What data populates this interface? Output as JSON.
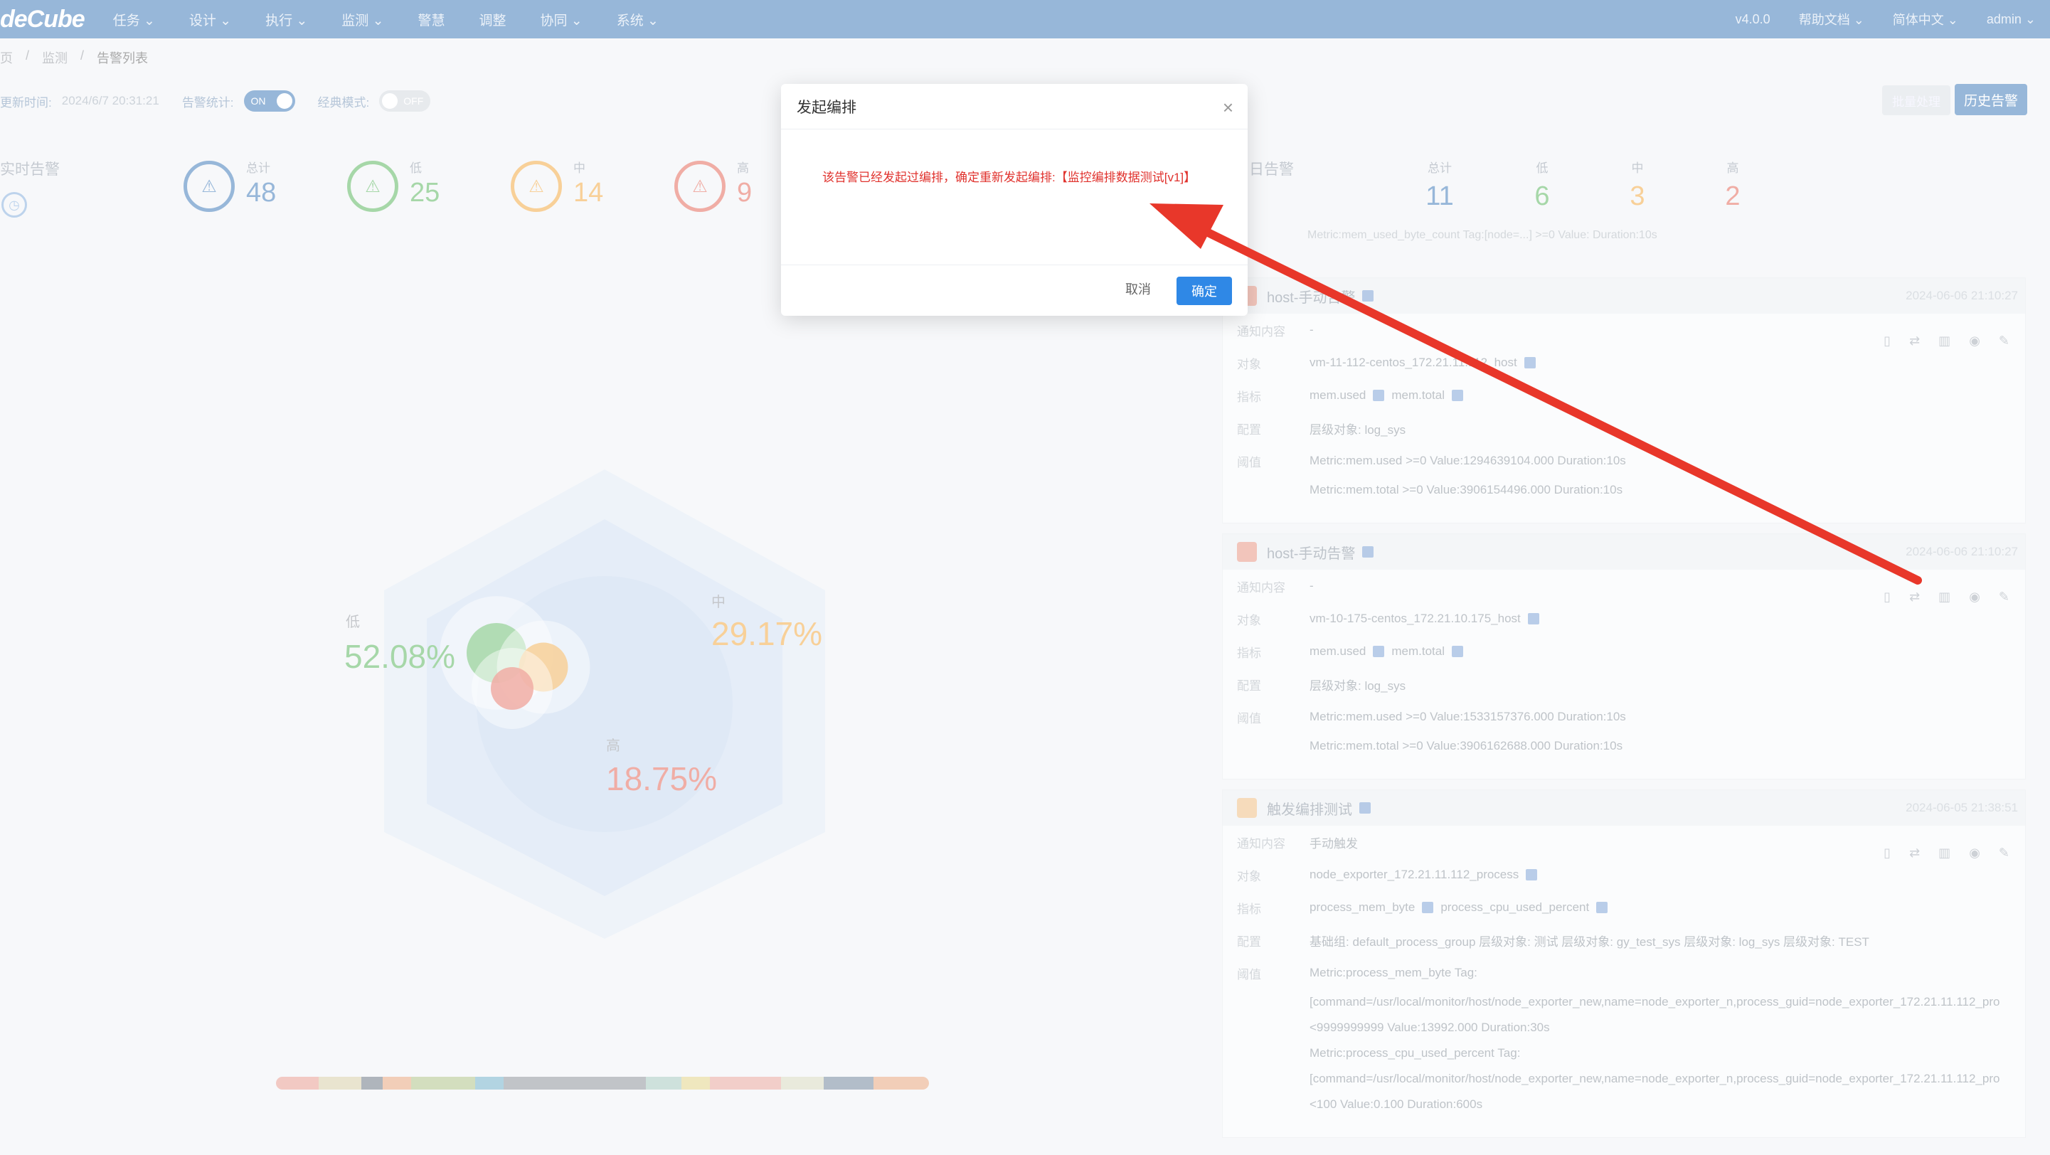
{
  "nav": {
    "logo": "deCube",
    "items": [
      "任务 ⌄",
      "设计 ⌄",
      "执行 ⌄",
      "监测 ⌄",
      "警慧",
      "调整",
      "协同 ⌄",
      "系统 ⌄"
    ],
    "version": "v4.0.0",
    "help": "帮助文档 ⌄",
    "lang": "简体中文 ⌄",
    "user": "admin ⌄"
  },
  "breadcrumb": [
    "页",
    "/",
    "监测",
    "/",
    "告警列表"
  ],
  "toolbar": {
    "update_label": "更新时间:",
    "update_time": "2024/6/7 20:31:21",
    "stats_label": "告警统计:",
    "stats_toggle": "ON",
    "classic_label": "经典模式:",
    "classic_toggle": "OFF",
    "disabled_btn": "批量处理",
    "history_btn": "历史告警"
  },
  "realtime": {
    "title": "实时告警",
    "stats": [
      {
        "label": "总计",
        "value": "48",
        "color": "#2f6fb3"
      },
      {
        "label": "低",
        "value": "25",
        "color": "#4caf50"
      },
      {
        "label": "中",
        "value": "14",
        "color": "#f0a030"
      },
      {
        "label": "高",
        "value": "9",
        "color": "#e05a4a"
      }
    ]
  },
  "chart_data": {
    "type": "pie",
    "categories": [
      "低",
      "中",
      "高"
    ],
    "values": [
      52.08,
      29.17,
      18.75
    ],
    "labels": [
      "52.08%",
      "29.17%",
      "18.75%"
    ],
    "colors": [
      "#4caf50",
      "#f0a030",
      "#e05a4a"
    ]
  },
  "history": {
    "title": "日告警",
    "stats": [
      {
        "label": "总计",
        "value": "11",
        "color": "#2f6fb3"
      },
      {
        "label": "低",
        "value": "6",
        "color": "#4caf50"
      },
      {
        "label": "中",
        "value": "3",
        "color": "#f0a030"
      },
      {
        "label": "高",
        "value": "2",
        "color": "#e05a4a"
      }
    ],
    "top_line": "Metric:mem_used_byte_count Tag:[node=...] >=0 Value:  Duration:10s"
  },
  "cards": [
    {
      "title": "host-手动告警",
      "time": "2024-06-06 21:10:27",
      "notify_k": "通知内容",
      "notify": "-",
      "object_k": "对象",
      "object": "vm-11-112-centos_172.21.11.112_host",
      "metric_k": "指标",
      "metric1": "mem.used",
      "metric2": "mem.total",
      "config_k": "配置",
      "config": "层级对象: log_sys",
      "threshold_k": "阈值",
      "threshold": [
        "Metric:mem.used >=0 Value:1294639104.000 Duration:10s",
        "Metric:mem.total >=0 Value:3906154496.000 Duration:10s"
      ]
    },
    {
      "title": "host-手动告警",
      "time": "2024-06-06 21:10:27",
      "notify_k": "通知内容",
      "notify": "-",
      "object_k": "对象",
      "object": "vm-10-175-centos_172.21.10.175_host",
      "metric_k": "指标",
      "metric1": "mem.used",
      "metric2": "mem.total",
      "config_k": "配置",
      "config": "层级对象: log_sys",
      "threshold_k": "阈值",
      "threshold": [
        "Metric:mem.used >=0 Value:1533157376.000 Duration:10s",
        "Metric:mem.total >=0 Value:3906162688.000 Duration:10s"
      ]
    },
    {
      "title": "触发编排测试",
      "time": "2024-06-05 21:38:51",
      "notify_k": "通知内容",
      "notify": "手动触发",
      "object_k": "对象",
      "object": "node_exporter_172.21.11.112_process",
      "metric_k": "指标",
      "metric1": "process_mem_byte",
      "metric2": "process_cpu_used_percent",
      "config_k": "配置",
      "config": "基础组: default_process_group  层级对象: 测试  层级对象: gy_test_sys  层级对象: log_sys  层级对象: TEST",
      "threshold_k": "阈值",
      "threshold": [
        "Metric:process_mem_byte Tag:",
        "[command=/usr/local/monitor/host/node_exporter_new,name=node_exporter_n,process_guid=node_exporter_172.21.11.112_pro",
        "<9999999999 Value:13992.000 Duration:30s",
        "Metric:process_cpu_used_percent Tag:",
        "[command=/usr/local/monitor/host/node_exporter_new,name=node_exporter_n,process_guid=node_exporter_172.21.11.112_pro",
        "<100 Value:0.100 Duration:600s"
      ]
    }
  ],
  "modal": {
    "title": "发起编排",
    "message": "该告警已经发起过编排，确定重新发起编排:【监控编排数据测试[v1]】",
    "cancel": "取消",
    "ok": "确定",
    "close_icon": "close-icon"
  }
}
